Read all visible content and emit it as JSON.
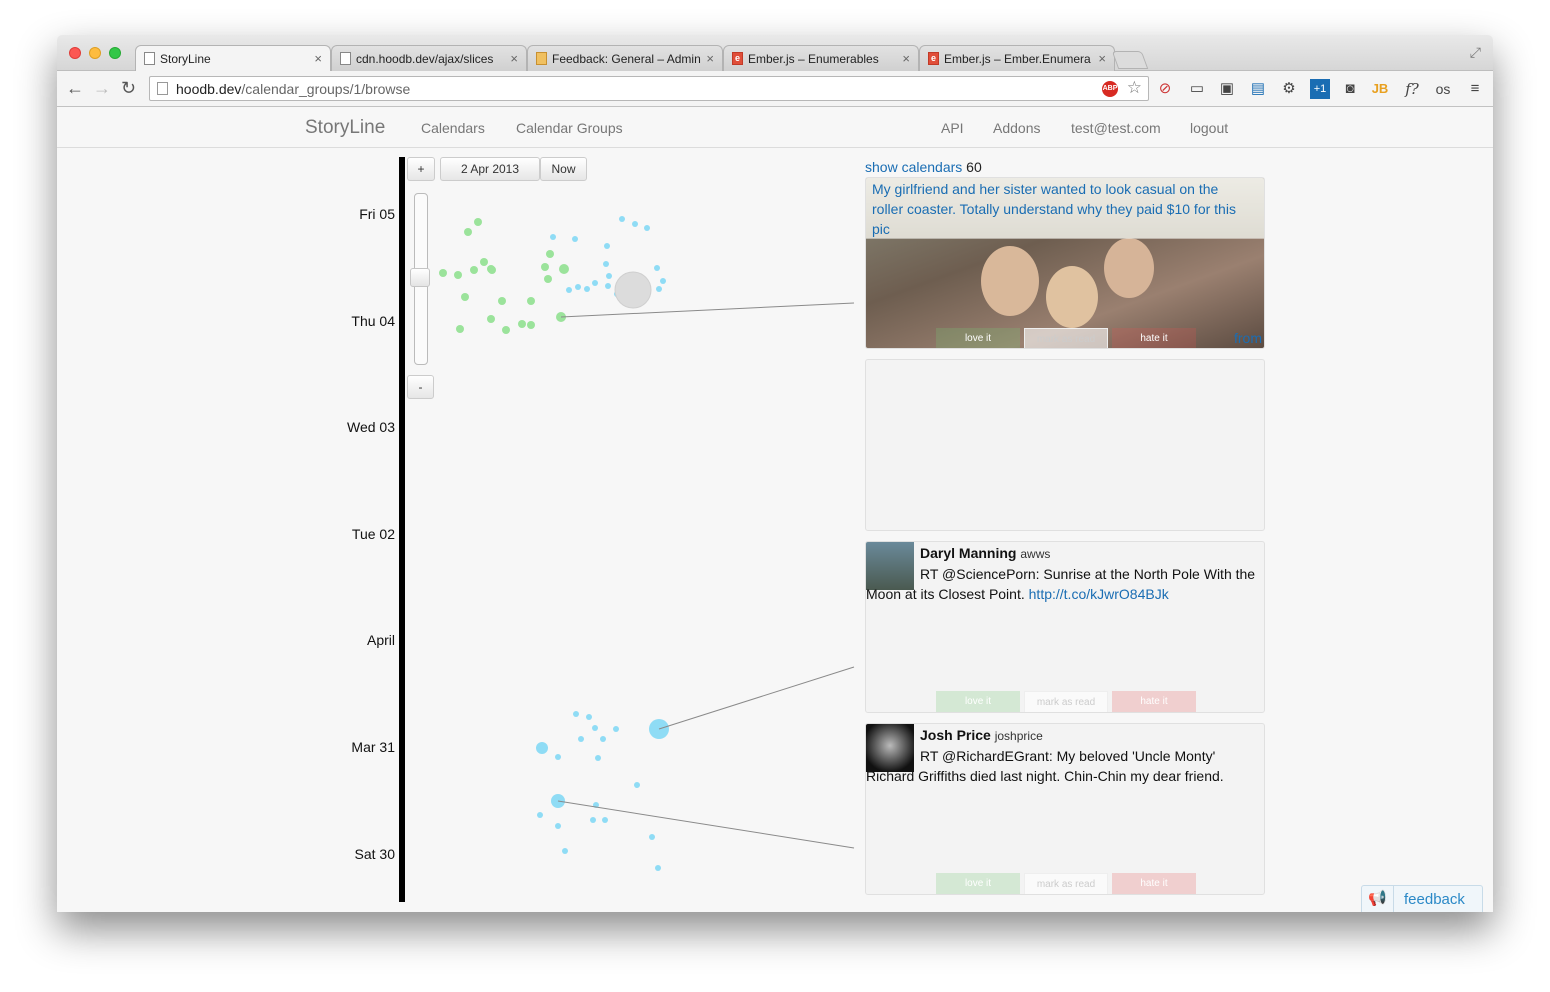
{
  "browser": {
    "tabs": [
      {
        "title": "StoryLine",
        "icon": "page-icon"
      },
      {
        "title": "cdn.hoodb.dev/ajax/slices",
        "icon": "page-icon"
      },
      {
        "title": "Feedback: General – Admin",
        "icon": "feedback-icon"
      },
      {
        "title": "Ember.js – Enumerables",
        "icon": "ember-icon"
      },
      {
        "title": "Ember.js – Ember.Enumera",
        "icon": "ember-icon"
      }
    ],
    "url_host": "hoodb.dev",
    "url_path": "/calendar_groups/1/browse",
    "abp_label": "ABP"
  },
  "app": {
    "brand": "StoryLine",
    "nav_left": [
      "Calendars",
      "Calendar Groups"
    ],
    "nav_right": [
      "API",
      "Addons",
      "test@test.com",
      "logout"
    ]
  },
  "timeline": {
    "zoom_in": "+",
    "zoom_out": "-",
    "date": "2 Apr 2013",
    "now": "Now",
    "days": [
      "Fri 05",
      "Thu 04",
      "Wed 03",
      "Tue 02",
      "April",
      "Mar 31",
      "Sat 30"
    ]
  },
  "panel": {
    "show_calendars": "show calendars",
    "count": "60",
    "photo_card": {
      "caption": "My girlfriend and her sister wanted to look casual on the roller coaster. Totally understand why they paid $10 for this pic",
      "from": "from"
    },
    "tweets": [
      {
        "name": "Daryl Manning",
        "handle": "awws",
        "text": "RT @SciencePorn: Sunrise at the North Pole With the Moon at its Closest Point. ",
        "link": "http://t.co/kJwrO84BJk"
      },
      {
        "name": "Josh Price",
        "handle": "joshprice",
        "text": "RT @RichardEGrant: My beloved 'Uncle Monty' Richard Griffiths died last night. Chin-Chin my dear friend.",
        "link": ""
      }
    ],
    "actions": {
      "love": "love it",
      "read": "mark as read",
      "hate": "hate it"
    }
  },
  "feedback": "feedback",
  "colors": {
    "green_dot": "#9be39b",
    "blue_dot": "#8fdcf5",
    "link": "#1a6db3"
  }
}
